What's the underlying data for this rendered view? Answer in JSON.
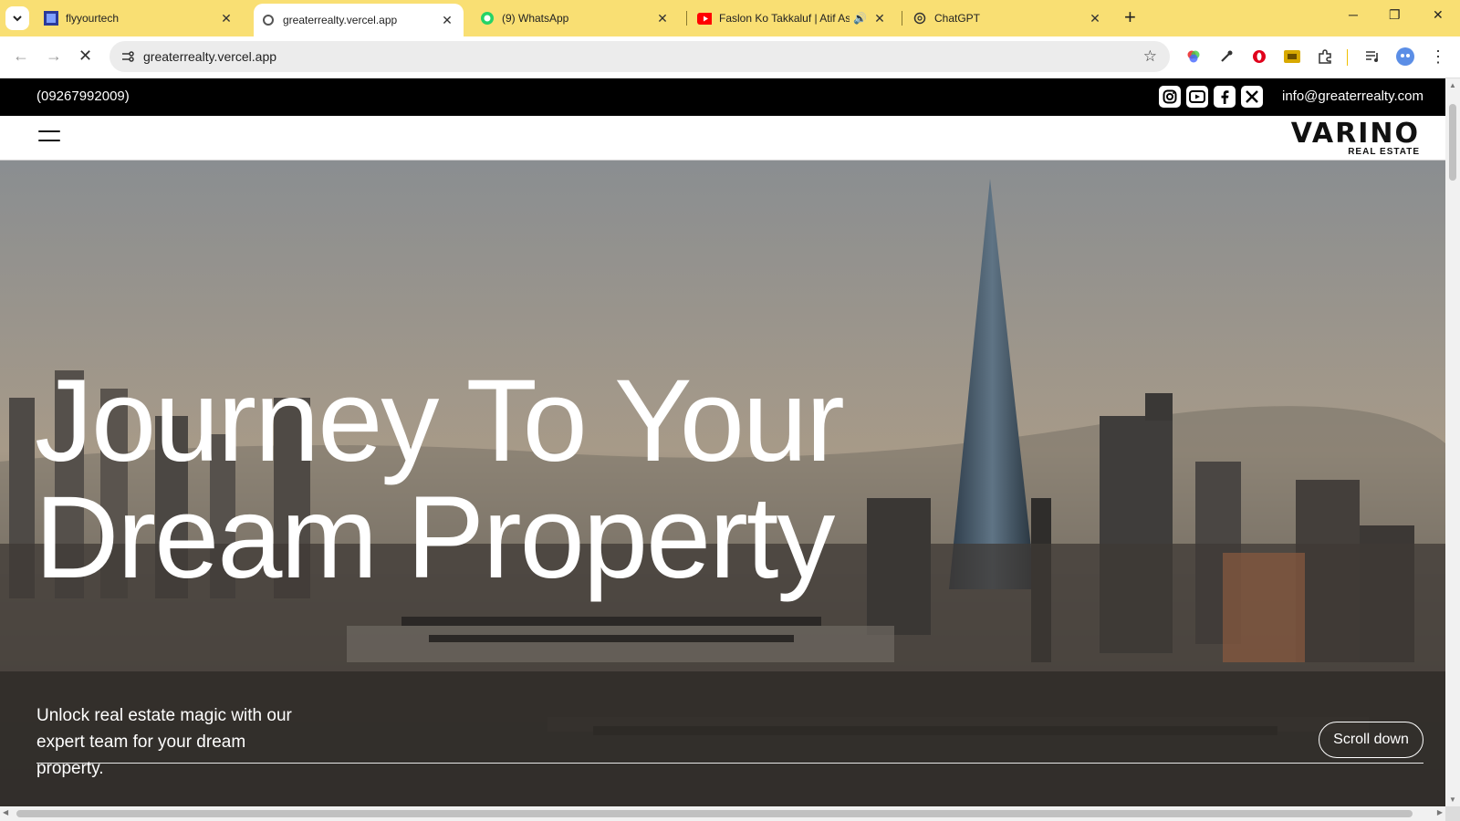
{
  "browser": {
    "tabs": [
      {
        "title": "flyyourtech",
        "icon": "flyyourtech-favicon",
        "active": false
      },
      {
        "title": "greaterrealty.vercel.app",
        "icon": "vercel-favicon",
        "active": true
      },
      {
        "title": "(9) WhatsApp",
        "icon": "whatsapp-favicon",
        "active": false
      },
      {
        "title": "Faslon Ko Takkaluf | Atif Aslam",
        "icon": "youtube-favicon",
        "active": false,
        "audio": true
      },
      {
        "title": "ChatGPT",
        "icon": "chatgpt-favicon",
        "active": false
      }
    ],
    "url": "greaterrealty.vercel.app"
  },
  "site": {
    "phone": "(09267992009)",
    "email": "info@greaterrealty.com",
    "social_icons": [
      "instagram-icon",
      "youtube-icon",
      "facebook-icon",
      "x-icon"
    ],
    "logo_main": "VARINO",
    "logo_sub": "REAL ESTATE",
    "hero": {
      "title_line1": "Journey To Your",
      "title_line2": "Dream Property",
      "subtitle": "Unlock real estate magic with our expert team for your dream property.",
      "scroll_label": "Scroll down"
    }
  },
  "colors": {
    "tabstrip": "#f9df73",
    "topbar": "#000000",
    "hero_text": "#ffffff"
  }
}
